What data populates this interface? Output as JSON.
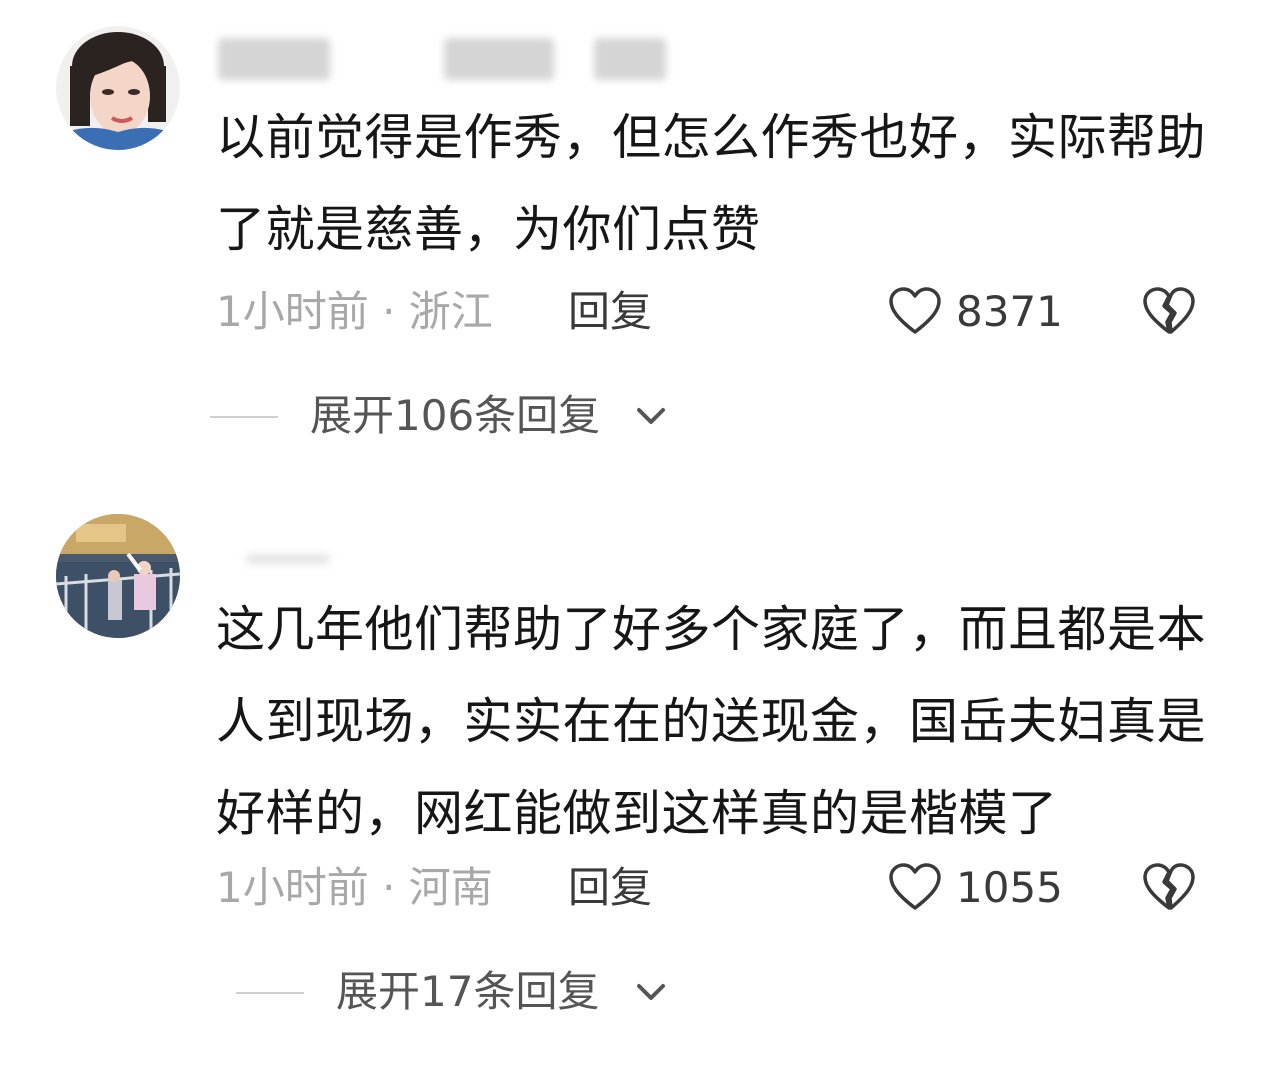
{
  "comments": [
    {
      "text": "以前觉得是作秀，但怎么作秀也好，实际帮助了就是慈善，为你们点赞",
      "time_location": "1小时前 · 浙江",
      "reply_label": "回复",
      "like_count": "8371",
      "expand_label": "展开106条回复"
    },
    {
      "text": "这几年他们帮助了好多个家庭了，而且都是本人到现场，实实在在的送现金，国岳夫妇真是好样的，网红能做到这样真的是楷模了",
      "time_location": "1小时前 · 河南",
      "reply_label": "回复",
      "like_count": "1055",
      "expand_label": "展开17条回复"
    }
  ],
  "colors": {
    "text_primary": "#161616",
    "text_secondary": "#a8a8a8",
    "icon": "#3a3a3a"
  },
  "icons": [
    "heart-outline-icon",
    "broken-heart-icon",
    "chevron-down-icon"
  ]
}
